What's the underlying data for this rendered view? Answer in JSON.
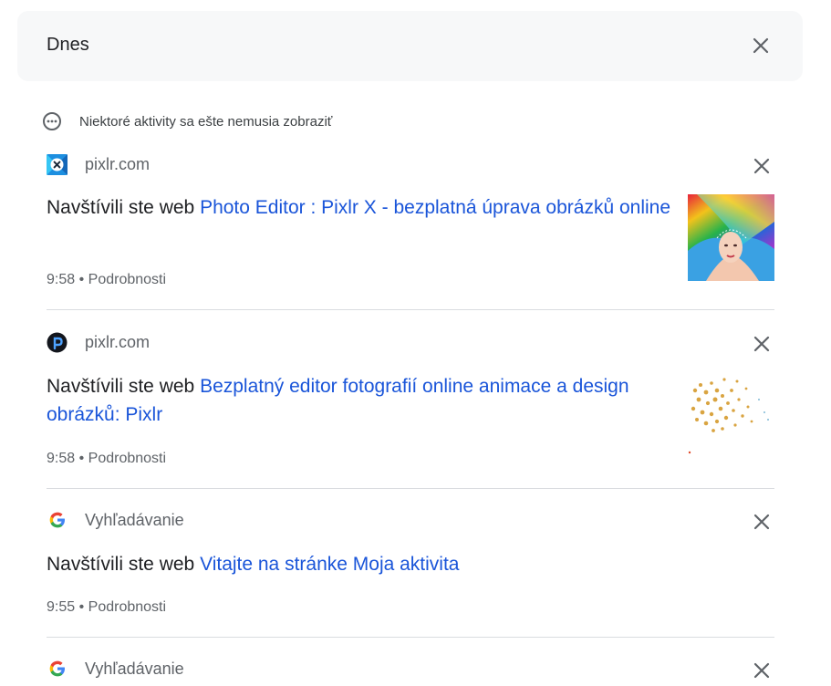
{
  "header": {
    "title": "Dnes"
  },
  "notice": {
    "text": "Niektoré aktivity sa ešte nemusia zobraziť"
  },
  "items": [
    {
      "site": "pixlr.com",
      "favicon": "pixlr-x-icon",
      "prefix": "Navštívili ste web ",
      "link": "Photo Editor : Pixlr X - bezplatná úprava obrázků online",
      "time": "9:58",
      "separator": " • ",
      "details": "Podrobnosti",
      "thumbnail": "colorful-hair-portrait"
    },
    {
      "site": "pixlr.com",
      "favicon": "pixlr-logo-icon",
      "prefix": "Navštívili ste web ",
      "link": "Bezplatný editor fotografií online animace a design obrázků: Pixlr",
      "time": "9:58",
      "separator": " • ",
      "details": "Podrobnosti",
      "thumbnail": "scattered-stars-pattern"
    },
    {
      "site": "Vyhľadávanie",
      "favicon": "google-icon",
      "prefix": "Navštívili ste web ",
      "link": "Vitajte na stránke Moja aktivita",
      "time": "9:55",
      "separator": " • ",
      "details": "Podrobnosti"
    },
    {
      "site": "Vyhľadávanie",
      "favicon": "google-icon"
    }
  ],
  "colors": {
    "link": "#1a55d9",
    "header_bg": "#f7f8f9",
    "divider": "#dadce0"
  }
}
